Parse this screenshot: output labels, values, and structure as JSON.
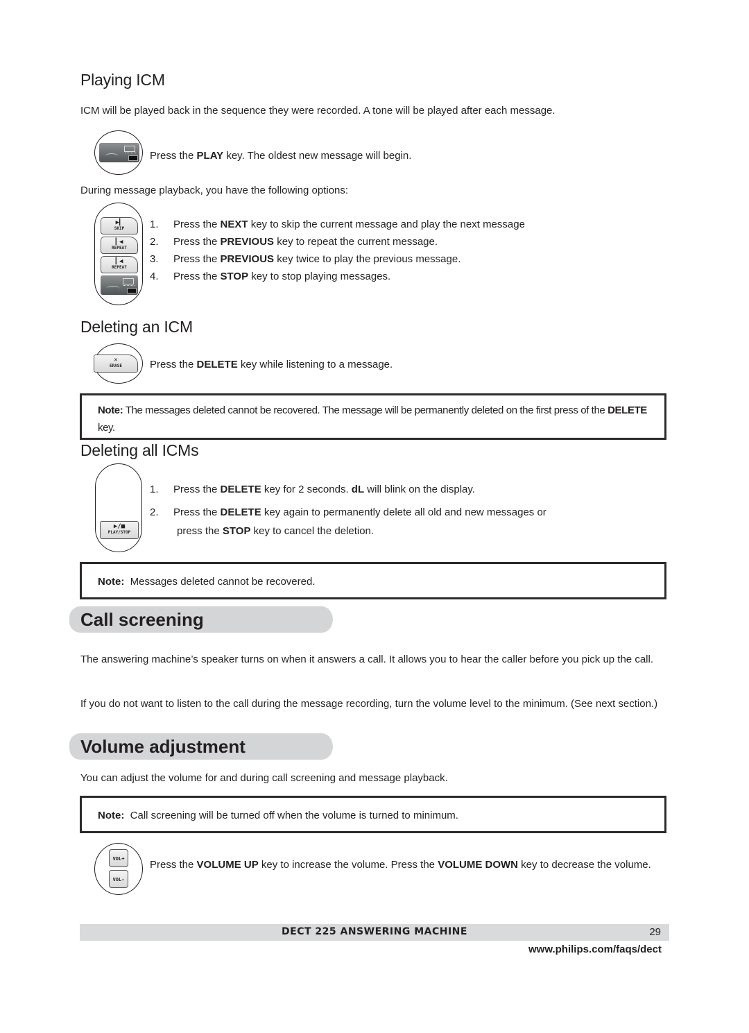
{
  "playing_icm": {
    "heading": "Playing ICM",
    "intro": "ICM will be played back in the sequence they were recorded.  A tone will be played after each message.",
    "play_step": {
      "pre": "Press the ",
      "key": "PLAY",
      "post": " key. The oldest new message will begin."
    },
    "options_intro": "During message playback, you have the following options:",
    "options": [
      {
        "num": "1.",
        "pre": "Press the ",
        "key": "NEXT",
        "post": " key to skip the current message and play the next message"
      },
      {
        "num": "2.",
        "pre": "Press the ",
        "key": "PREVIOUS",
        "post": " key to repeat the current message."
      },
      {
        "num": "3.",
        "pre": "Press the ",
        "key": "PREVIOUS",
        "post": " key twice to play the previous message."
      },
      {
        "num": "4.",
        "pre": "Press the ",
        "key": "STOP",
        "post": " key to stop playing messages."
      }
    ],
    "icon_keys": {
      "skip": "SKIP",
      "repeat": "REPEAT",
      "skip_glyph": "▶▎",
      "repeat_glyph": "▎◀"
    }
  },
  "deleting_icm": {
    "heading": "Deleting an ICM",
    "step": {
      "pre": "Press the ",
      "key": "DELETE",
      "post": " key while listening to a message."
    },
    "icon_key": {
      "glyph": "✕",
      "label": "ERASE"
    },
    "note": {
      "label": "Note:",
      "text": " The messages deleted cannot be recovered.  The message will be permanently deleted on the first press of the ",
      "key": "DELETE",
      "post": " key."
    }
  },
  "deleting_all": {
    "heading": "Deleting all ICMs",
    "steps": [
      {
        "num": "1.",
        "pre": "Press the ",
        "key": "DELETE",
        "mid": " key for 2 seconds.  ",
        "key2": "dL",
        "post": " will blink on the display."
      },
      {
        "num": "2.",
        "pre": "Press the ",
        "key": "DELETE",
        "post": " key again to permanently delete all old and new messages or"
      }
    ],
    "continuation": {
      "pre": "press the ",
      "key": "STOP",
      "post": " key to cancel the deletion."
    },
    "icon_key": {
      "glyph": "▶/■",
      "label": "PLAY/STOP"
    },
    "note": {
      "label": "Note:",
      "text": "  Messages deleted cannot be recovered."
    }
  },
  "call_screening": {
    "title": "Call screening",
    "paragraphs": [
      "The answering machine’s speaker turns on when it answers a call.  It allows you to hear the caller before you pick up the call.",
      "If you do not want to listen to the call during the message recording, turn the volume level to the minimum.  (See next section.)"
    ]
  },
  "volume_adjustment": {
    "title": "Volume adjustment",
    "intro": "You can adjust the volume for and during call screening and message playback.",
    "note": {
      "label": "Note:",
      "text": "  Call screening will be turned off when the volume is turned to minimum."
    },
    "step": {
      "pre": "Press the ",
      "key": "VOLUME UP",
      "mid": " key to increase the volume.  Press the ",
      "key2": "VOLUME DOWN",
      "post": " key to decrease the volume."
    },
    "icon_keys": {
      "up": "VOL+",
      "down": "VOL-"
    }
  },
  "footer": {
    "title": "DECT 225 ANSWERING MACHINE",
    "page": "29",
    "url": "www.philips.com/faqs/dect"
  }
}
